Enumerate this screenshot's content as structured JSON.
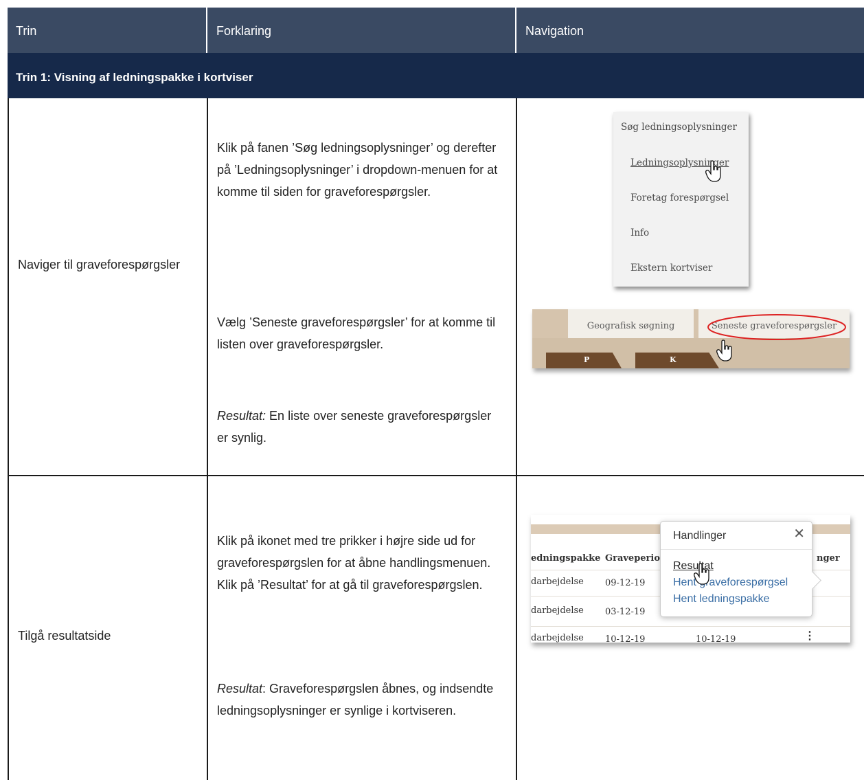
{
  "header": {
    "col1": "Trin",
    "col2": "Forklaring",
    "col3": "Navigation"
  },
  "section": {
    "title": "Trin 1: Visning af ledningspakke i kortviser"
  },
  "rows": [
    {
      "step": "Naviger til graveforespørgsler",
      "p1": "Klik på fanen ’Søg ledningsoplysninger’ og derefter på ’Ledningsoplysninger’ i dropdown-menuen for at komme til siden for graveforespørgsler.",
      "p2": "Vælg ’Seneste graveforespørgsler’ for at komme til listen over graveforespørgsler.",
      "result_label": "Resultat:",
      "result_text": " En liste over seneste graveforespørgsler er synlig."
    },
    {
      "step": "Tilgå resultatside",
      "p1": "Klik på ikonet med tre prikker i højre side ud for graveforespørgslen for at åbne handlingsmenuen. Klik på ’Resultat’ for at gå til graveforespørgslen.",
      "result_label": "Resultat",
      "result_text": ": Graveforespørgslen åbnes, og indsendte ledningsoplysninger er synlige i kortviseren."
    }
  ],
  "shot1": {
    "menu_title": "Søg ledningsoplysninger",
    "items": [
      "Ledningsoplysninger",
      "Foretag forespørgsel",
      "Info",
      "Ekstern kortviser"
    ]
  },
  "shot2": {
    "tab1": "Geografisk søgning",
    "tab2": "Seneste graveforespørgsler",
    "sub1": "P",
    "sub2": "K"
  },
  "shot3": {
    "col_ledningspakke": "edningspakke",
    "col_graveperiode": "Graveperiode",
    "col_handlinger": "nger",
    "rows": [
      {
        "type": "darbejdelse",
        "date": "09-12-19"
      },
      {
        "type": "darbejdelse",
        "date": "03-12-19"
      },
      {
        "type": "darbejdelse",
        "date": "10-12-19",
        "date2": "10-12-19"
      }
    ],
    "popup_title": "Handlinger",
    "actions": [
      "Resultat",
      "Hent graveforespørgsel",
      "Hent ledningspakke"
    ]
  }
}
